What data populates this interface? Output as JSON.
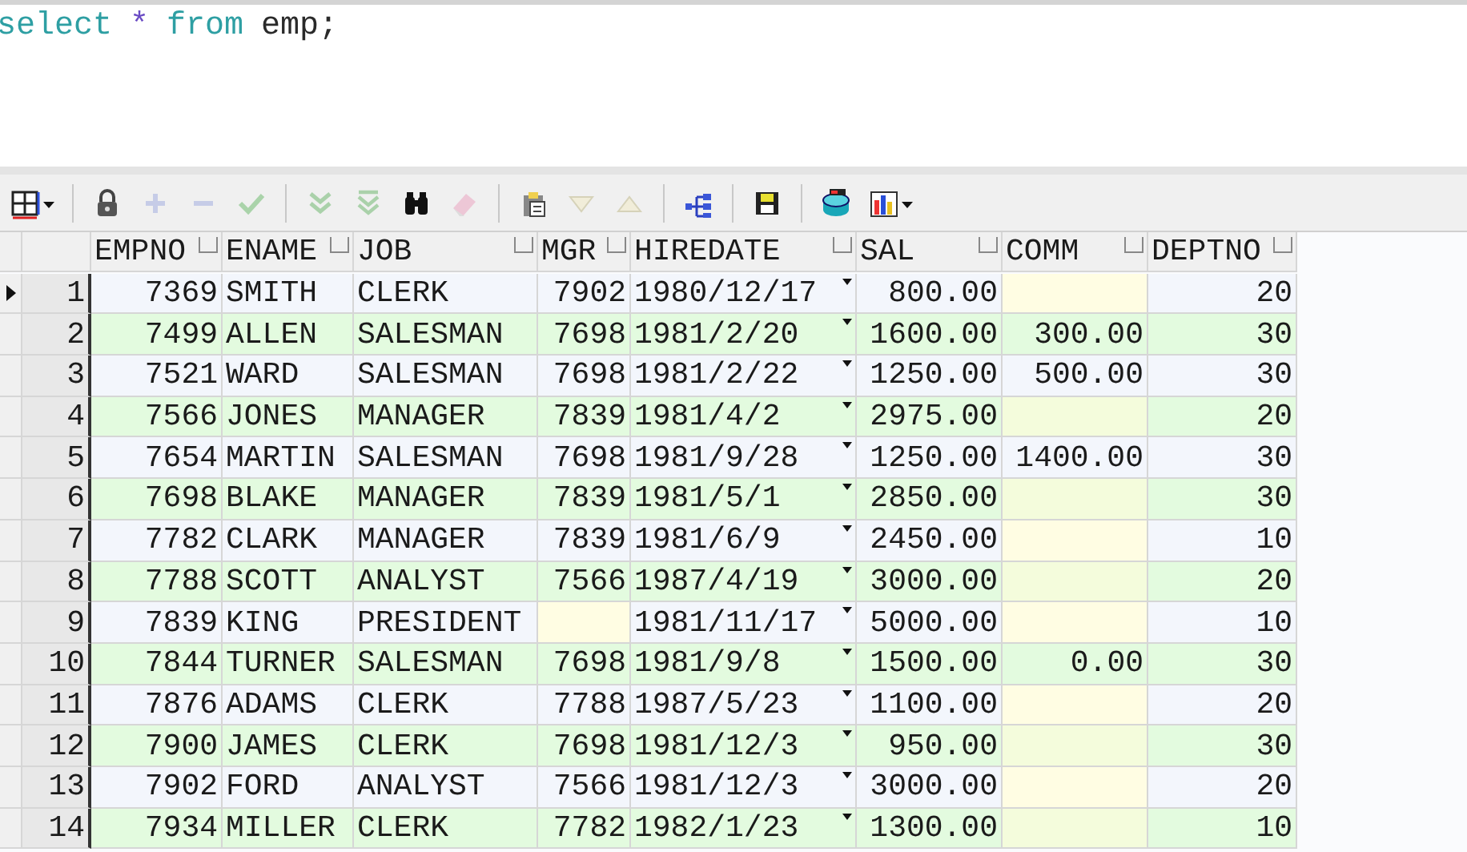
{
  "editor": {
    "tokens": [
      {
        "kind": "keyword",
        "text": "select"
      },
      {
        "kind": "operator",
        "text": "*"
      },
      {
        "kind": "keyword",
        "text": "from"
      },
      {
        "kind": "identifier",
        "text": "emp;"
      }
    ]
  },
  "toolbar": [
    {
      "kind": "grid",
      "disabled": false,
      "menu": true
    },
    {
      "kind": "separator"
    },
    {
      "kind": "lock",
      "disabled": false
    },
    {
      "kind": "plus",
      "disabled": true
    },
    {
      "kind": "minus",
      "disabled": true
    },
    {
      "kind": "check",
      "disabled": true
    },
    {
      "kind": "separator"
    },
    {
      "kind": "next",
      "disabled": true
    },
    {
      "kind": "last",
      "disabled": true
    },
    {
      "kind": "binoculars",
      "disabled": false
    },
    {
      "kind": "eraser",
      "disabled": true
    },
    {
      "kind": "separator"
    },
    {
      "kind": "clipboard",
      "disabled": false
    },
    {
      "kind": "down",
      "disabled": true
    },
    {
      "kind": "up",
      "disabled": true
    },
    {
      "kind": "separator"
    },
    {
      "kind": "tree",
      "disabled": false
    },
    {
      "kind": "separator"
    },
    {
      "kind": "save",
      "disabled": false
    },
    {
      "kind": "separator"
    },
    {
      "kind": "database",
      "disabled": false
    },
    {
      "kind": "chart",
      "disabled": false,
      "menu": true
    }
  ],
  "grid": {
    "columns": [
      {
        "label": "EMPNO",
        "kind": "number"
      },
      {
        "label": "ENAME",
        "kind": "text"
      },
      {
        "label": "JOB",
        "kind": "text"
      },
      {
        "label": "MGR",
        "kind": "number"
      },
      {
        "label": "HIREDATE",
        "kind": "date"
      },
      {
        "label": "SAL",
        "kind": "number"
      },
      {
        "label": "COMM",
        "kind": "number"
      },
      {
        "label": "DEPTNO",
        "kind": "number"
      }
    ],
    "rows": [
      {
        "number": "1",
        "current": true,
        "cells": [
          "7369",
          "SMITH",
          "CLERK",
          "7902",
          "1980/12/17",
          "800.00",
          null,
          "20"
        ]
      },
      {
        "number": "2",
        "current": false,
        "cells": [
          "7499",
          "ALLEN",
          "SALESMAN",
          "7698",
          "1981/2/20",
          "1600.00",
          "300.00",
          "30"
        ]
      },
      {
        "number": "3",
        "current": false,
        "cells": [
          "7521",
          "WARD",
          "SALESMAN",
          "7698",
          "1981/2/22",
          "1250.00",
          "500.00",
          "30"
        ]
      },
      {
        "number": "4",
        "current": false,
        "cells": [
          "7566",
          "JONES",
          "MANAGER",
          "7839",
          "1981/4/2",
          "2975.00",
          null,
          "20"
        ]
      },
      {
        "number": "5",
        "current": false,
        "cells": [
          "7654",
          "MARTIN",
          "SALESMAN",
          "7698",
          "1981/9/28",
          "1250.00",
          "1400.00",
          "30"
        ]
      },
      {
        "number": "6",
        "current": false,
        "cells": [
          "7698",
          "BLAKE",
          "MANAGER",
          "7839",
          "1981/5/1",
          "2850.00",
          null,
          "30"
        ]
      },
      {
        "number": "7",
        "current": false,
        "cells": [
          "7782",
          "CLARK",
          "MANAGER",
          "7839",
          "1981/6/9",
          "2450.00",
          null,
          "10"
        ]
      },
      {
        "number": "8",
        "current": false,
        "cells": [
          "7788",
          "SCOTT",
          "ANALYST",
          "7566",
          "1987/4/19",
          "3000.00",
          null,
          "20"
        ]
      },
      {
        "number": "9",
        "current": false,
        "cells": [
          "7839",
          "KING",
          "PRESIDENT",
          null,
          "1981/11/17",
          "5000.00",
          null,
          "10"
        ]
      },
      {
        "number": "10",
        "current": false,
        "cells": [
          "7844",
          "TURNER",
          "SALESMAN",
          "7698",
          "1981/9/8",
          "1500.00",
          "0.00",
          "30"
        ]
      },
      {
        "number": "11",
        "current": false,
        "cells": [
          "7876",
          "ADAMS",
          "CLERK",
          "7788",
          "1987/5/23",
          "1100.00",
          null,
          "20"
        ]
      },
      {
        "number": "12",
        "current": false,
        "cells": [
          "7900",
          "JAMES",
          "CLERK",
          "7698",
          "1981/12/3",
          "950.00",
          null,
          "30"
        ]
      },
      {
        "number": "13",
        "current": false,
        "cells": [
          "7902",
          "FORD",
          "ANALYST",
          "7566",
          "1981/12/3",
          "3000.00",
          null,
          "20"
        ]
      },
      {
        "number": "14",
        "current": false,
        "cells": [
          "7934",
          "MILLER",
          "CLERK",
          "7782",
          "1982/1/23",
          "1300.00",
          null,
          "10"
        ]
      }
    ]
  }
}
